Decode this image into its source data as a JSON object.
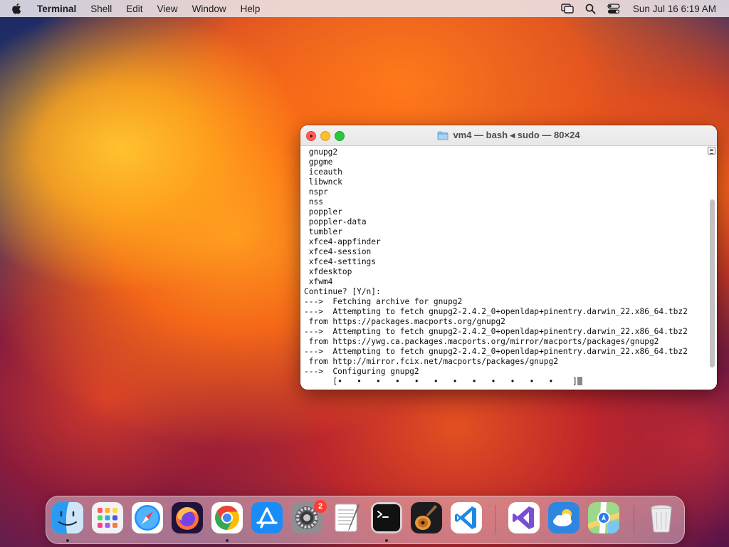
{
  "menubar": {
    "app_name": "Terminal",
    "items": [
      "Shell",
      "Edit",
      "View",
      "Window",
      "Help"
    ],
    "clock": "Sun Jul 16  6:19 AM"
  },
  "terminal": {
    "title": "vm4 — bash ◂ sudo — 80×24",
    "lines": [
      " gnupg2",
      " gpgme",
      " iceauth",
      " libwnck",
      " nspr",
      " nss",
      " poppler",
      " poppler-data",
      " tumbler",
      " xfce4-appfinder",
      " xfce4-session",
      " xfce4-settings",
      " xfdesktop",
      " xfwm4",
      "Continue? [Y/n]:",
      "--->  Fetching archive for gnupg2",
      "--->  Attempting to fetch gnupg2-2.4.2_0+openldap+pinentry.darwin_22.x86_64.tbz2",
      " from https://packages.macports.org/gnupg2",
      "--->  Attempting to fetch gnupg2-2.4.2_0+openldap+pinentry.darwin_22.x86_64.tbz2",
      " from https://ywg.ca.packages.macports.org/mirror/macports/packages/gnupg2",
      "--->  Attempting to fetch gnupg2-2.4.2_0+openldap+pinentry.darwin_22.x86_64.tbz2",
      " from http://mirror.fcix.net/macports/packages/gnupg2",
      "--->  Configuring gnupg2",
      "      [•   •   •   •   •   •   •   •   •   •   •   •    ]"
    ]
  },
  "dock": {
    "apps": [
      {
        "name": "Finder",
        "icon": "finder-icon",
        "running": true
      },
      {
        "name": "Launchpad",
        "icon": "launchpad-icon",
        "running": false
      },
      {
        "name": "Safari",
        "icon": "safari-icon",
        "running": false
      },
      {
        "name": "Firefox",
        "icon": "firefox-icon",
        "running": false
      },
      {
        "name": "Google Chrome",
        "icon": "chrome-icon",
        "running": true
      },
      {
        "name": "App Store",
        "icon": "app-store-icon",
        "running": false
      },
      {
        "name": "System Settings",
        "icon": "system-settings-icon",
        "running": false,
        "badge": "2"
      },
      {
        "name": "TextEdit",
        "icon": "textedit-icon",
        "running": false
      },
      {
        "name": "Terminal",
        "icon": "terminal-icon",
        "running": true
      },
      {
        "name": "GarageBand",
        "icon": "garageband-icon",
        "running": false
      },
      {
        "name": "Visual Studio Code",
        "icon": "vscode-icon",
        "running": false
      },
      {
        "name": "Visual Studio",
        "icon": "visual-studio-icon",
        "running": false
      },
      {
        "name": "Weather",
        "icon": "weather-icon",
        "running": false
      },
      {
        "name": "Maps",
        "icon": "maps-icon",
        "running": false
      },
      {
        "name": "Trash",
        "icon": "trash-icon",
        "running": false
      }
    ]
  },
  "colors": {
    "close": "#ff5f57",
    "minimize": "#febc2e",
    "zoom": "#28c840",
    "badge": "#ff3b30"
  }
}
